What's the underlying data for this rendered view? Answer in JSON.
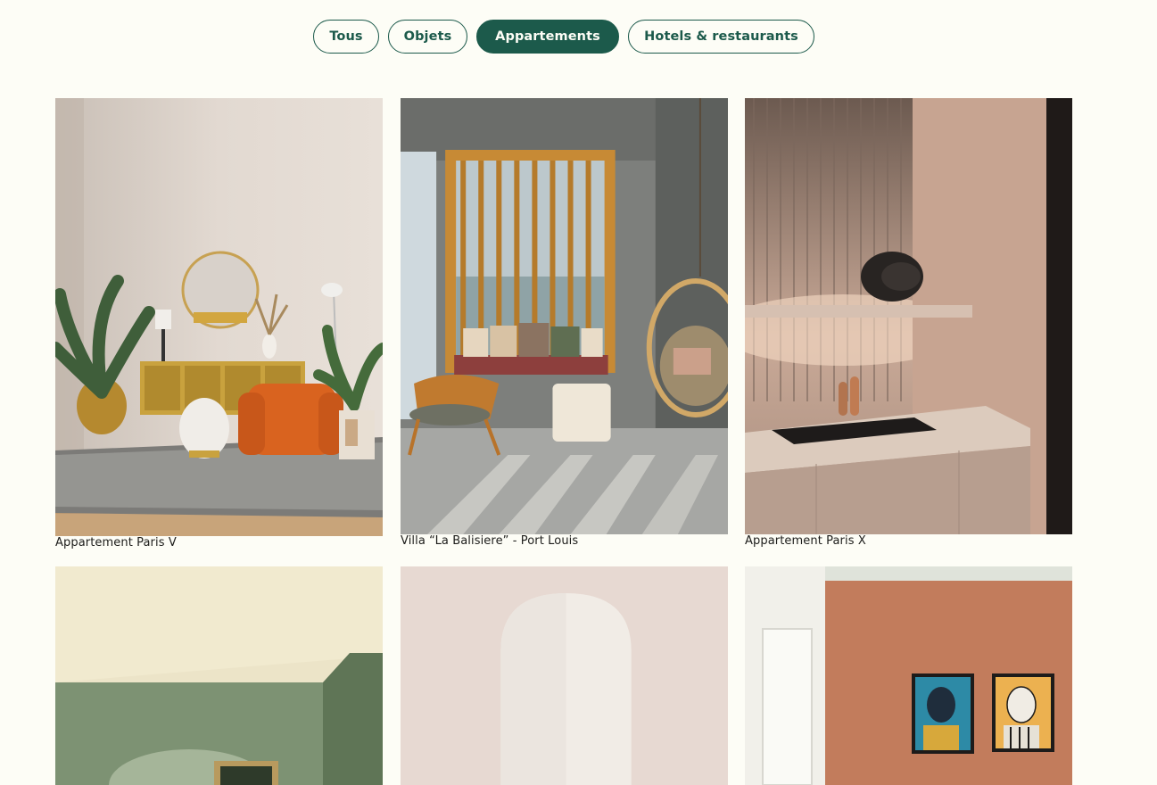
{
  "filters": {
    "items": [
      {
        "label": "Tous",
        "active": false
      },
      {
        "label": "Objets",
        "active": false
      },
      {
        "label": "Appartements",
        "active": true
      },
      {
        "label": "Hotels & restaurants",
        "active": false
      }
    ]
  },
  "gallery": {
    "items": [
      {
        "caption": "Appartement Paris V"
      },
      {
        "caption": "Villa “La Balisiere” - Port Louis"
      },
      {
        "caption": "Appartement Paris X"
      },
      {
        "caption": ""
      },
      {
        "caption": ""
      },
      {
        "caption": ""
      }
    ]
  },
  "colors": {
    "accent": "#1c5a4b",
    "background": "#fdfdf6",
    "text": "#1d1d1b"
  }
}
